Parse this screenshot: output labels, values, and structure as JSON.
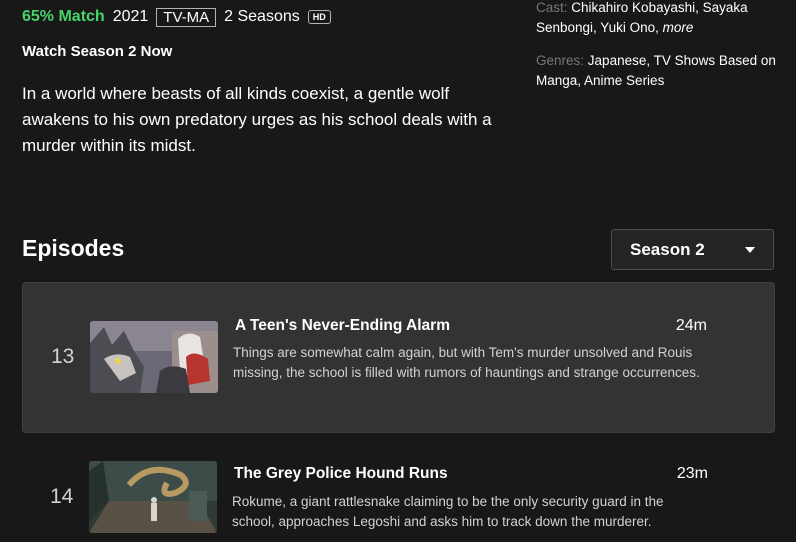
{
  "meta": {
    "match": "65% Match",
    "year": "2021",
    "rating": "TV-MA",
    "seasons": "2 Seasons",
    "quality": "HD"
  },
  "watch_label": "Watch Season 2 Now",
  "synopsis": "In a world where beasts of all kinds coexist, a gentle wolf awakens to his own predatory urges as his school deals with a murder within its midst.",
  "cast": {
    "label": "Cast:",
    "value": "Chikahiro Kobayashi, Sayaka Senbongi, Yuki Ono,",
    "more": "more"
  },
  "genres": {
    "label": "Genres:",
    "value": "Japanese, TV Shows Based on Manga, Anime Series"
  },
  "episodes_title": "Episodes",
  "season_select": {
    "selected": "Season 2"
  },
  "episodes": [
    {
      "number": "13",
      "title": "A Teen's Never-Ending Alarm",
      "duration": "24m",
      "description": "Things are somewhat calm again, but with Tem's murder unsolved and Rouis missing, the school is filled with rumors of hauntings and strange occurrences."
    },
    {
      "number": "14",
      "title": "The Grey Police Hound Runs",
      "duration": "23m",
      "description": "Rokume, a giant rattlesnake claiming to be the only security guard in the school, approaches Legoshi and asks him to track down the murderer."
    }
  ],
  "colors": {
    "background": "#181818",
    "match_green": "#46d369",
    "active_row": "#333333"
  }
}
